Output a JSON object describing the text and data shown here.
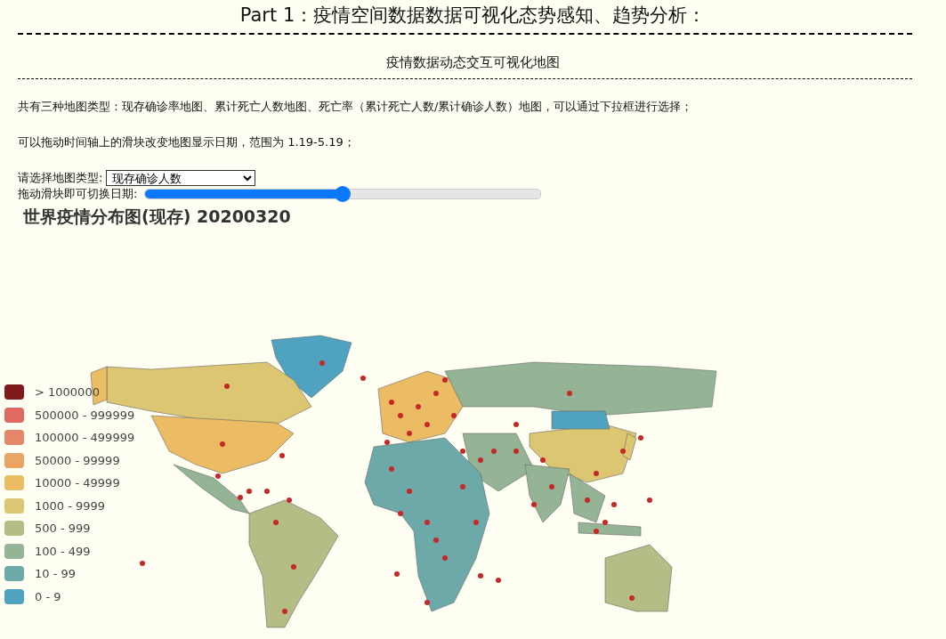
{
  "header": {
    "title": "Part 1：疫情空间数据数据可视化态势感知、趋势分析："
  },
  "section": {
    "title": "疫情数据动态交互可视化地图"
  },
  "paragraphs": [
    "共有三种地图类型：现存确诊率地图、累计死亡人数地图、死亡率（累计死亡人数/累计确诊人数）地图，可以通过下拉框进行选择；",
    "可以拖动时间轴上的滑块改变地图显示日期，范围为 1.19-5.19；"
  ],
  "map_type": {
    "label": "请选择地图类型:",
    "value": "现存确诊人数"
  },
  "date_slider": {
    "label": "拖动滑块即可切换日期:",
    "level": 0.5
  },
  "map": {
    "title": "世界疫情分布图(现存) 20200320",
    "legend": [
      {
        "label": "> 1000000",
        "color": "#7e1a1c"
      },
      {
        "label": "500000 - 999999",
        "color": "#e06a62"
      },
      {
        "label": "100000 - 499999",
        "color": "#e5866b"
      },
      {
        "label": "50000 - 99999",
        "color": "#e9a566"
      },
      {
        "label": "10000 - 49999",
        "color": "#ecbc65"
      },
      {
        "label": "1000 - 9999",
        "color": "#dcc672"
      },
      {
        "label": "500 - 999",
        "color": "#b6bc85"
      },
      {
        "label": "100 - 499",
        "color": "#95b496"
      },
      {
        "label": "10 - 99",
        "color": "#6ca9a8"
      },
      {
        "label": "0 - 9",
        "color": "#4fa3c1"
      }
    ]
  }
}
